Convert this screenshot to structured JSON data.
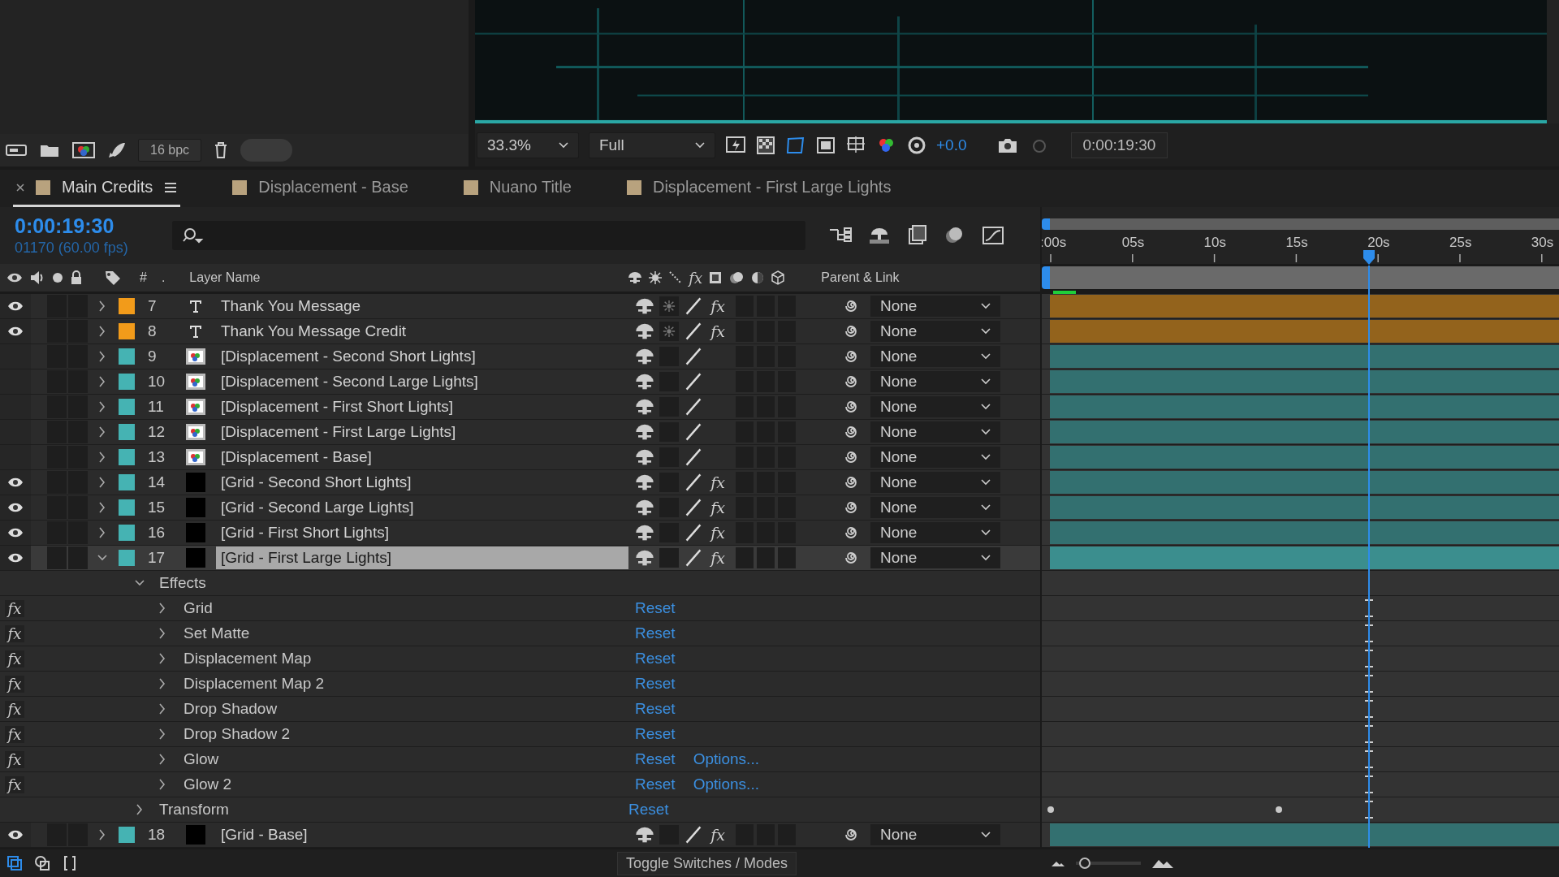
{
  "project_panel": {
    "bit_depth": "16 bpc"
  },
  "viewer": {
    "zoom": "33.3%",
    "resolution": "Full",
    "exposure": "+0.0",
    "timecode": "0:00:19:30"
  },
  "tabs": [
    {
      "label": "Main Credits",
      "selected": true
    },
    {
      "label": "Displacement - Base",
      "selected": false
    },
    {
      "label": "Nuano Title",
      "selected": false
    },
    {
      "label": "Displacement - First Large Lights",
      "selected": false
    }
  ],
  "timeline": {
    "current_time": "0:00:19:30",
    "frame_info": "01170 (60.00 fps)",
    "ruler": [
      ":00s",
      "05s",
      "10s",
      "15s",
      "20s",
      "25s",
      "30s"
    ]
  },
  "columns": {
    "number": "#",
    "marker": ".",
    "name": "Layer Name",
    "fx": "fx",
    "parent": "Parent & Link"
  },
  "layers": [
    {
      "number": "7",
      "name": "Thank You Message",
      "kind": "text",
      "color": "#f29b1a",
      "visible": true,
      "solo": false,
      "locked": false,
      "expanded": false,
      "selected": false,
      "collapse": true,
      "fx": "fx",
      "fx_on": true,
      "parent": "None"
    },
    {
      "number": "8",
      "name": "Thank You Message Credit",
      "kind": "text",
      "color": "#f29b1a",
      "visible": true,
      "solo": false,
      "locked": false,
      "expanded": false,
      "selected": false,
      "collapse": true,
      "fx": "fx",
      "fx_on": true,
      "parent": "None"
    },
    {
      "number": "9",
      "name": "[Displacement - Second Short Lights]",
      "kind": "precomp",
      "color": "#45b3b3",
      "visible": false,
      "solo": false,
      "locked": false,
      "expanded": false,
      "selected": false,
      "collapse": false,
      "parent": "None"
    },
    {
      "number": "10",
      "name": "[Displacement - Second Large Lights]",
      "kind": "precomp",
      "color": "#45b3b3",
      "visible": false,
      "solo": false,
      "locked": false,
      "expanded": false,
      "selected": false,
      "collapse": false,
      "parent": "None"
    },
    {
      "number": "11",
      "name": "[Displacement - First Short Lights]",
      "kind": "precomp",
      "color": "#45b3b3",
      "visible": false,
      "solo": false,
      "locked": false,
      "expanded": false,
      "selected": false,
      "collapse": false,
      "parent": "None"
    },
    {
      "number": "12",
      "name": "[Displacement - First Large Lights]",
      "kind": "precomp",
      "color": "#45b3b3",
      "visible": false,
      "solo": false,
      "locked": false,
      "expanded": false,
      "selected": false,
      "collapse": false,
      "parent": "None"
    },
    {
      "number": "13",
      "name": "[Displacement - Base]",
      "kind": "precomp",
      "color": "#45b3b3",
      "visible": false,
      "solo": false,
      "locked": false,
      "expanded": false,
      "selected": false,
      "collapse": false,
      "parent": "None"
    },
    {
      "number": "14",
      "name": "[Grid - Second Short Lights]",
      "kind": "solid",
      "color": "#45b3b3",
      "visible": true,
      "solo": false,
      "locked": false,
      "expanded": false,
      "selected": false,
      "collapse": false,
      "fx": "fx",
      "fx_on": true,
      "parent": "None"
    },
    {
      "number": "15",
      "name": "[Grid - Second Large Lights]",
      "kind": "solid",
      "color": "#45b3b3",
      "visible": true,
      "solo": false,
      "locked": false,
      "expanded": false,
      "selected": false,
      "collapse": false,
      "fx": "fx",
      "fx_on": true,
      "parent": "None"
    },
    {
      "number": "16",
      "name": "[Grid - First Short Lights]",
      "kind": "solid",
      "color": "#45b3b3",
      "visible": true,
      "solo": false,
      "locked": false,
      "expanded": false,
      "selected": false,
      "collapse": false,
      "fx": "fx",
      "fx_on": true,
      "parent": "None"
    },
    {
      "number": "17",
      "name": "[Grid - First Large Lights]",
      "kind": "solid",
      "color": "#45b3b3",
      "visible": true,
      "solo": false,
      "locked": false,
      "expanded": true,
      "selected": true,
      "collapse": false,
      "fx": "fx",
      "fx_on": true,
      "parent": "None",
      "effects": {
        "label": "Effects",
        "expanded": true,
        "items": [
          {
            "badge": "fx",
            "name": "Grid",
            "reset": "Reset"
          },
          {
            "badge": "fx",
            "name": "Set Matte",
            "reset": "Reset"
          },
          {
            "badge": "fx",
            "name": "Displacement Map",
            "reset": "Reset"
          },
          {
            "badge": "fx",
            "name": "Displacement Map 2",
            "reset": "Reset"
          },
          {
            "badge": "fx",
            "name": "Drop Shadow",
            "reset": "Reset"
          },
          {
            "badge": "fx",
            "name": "Drop Shadow 2",
            "reset": "Reset"
          },
          {
            "badge": "fx",
            "name": "Glow",
            "reset": "Reset",
            "options": "Options..."
          },
          {
            "badge": "fx",
            "name": "Glow 2",
            "reset": "Reset",
            "options": "Options..."
          }
        ]
      },
      "transform": {
        "label": "Transform",
        "reset": "Reset",
        "expanded": false
      }
    },
    {
      "number": "18",
      "name": "[Grid - Base]",
      "kind": "solid",
      "color": "#45b3b3",
      "visible": true,
      "solo": false,
      "locked": false,
      "expanded": false,
      "selected": false,
      "collapse": false,
      "fx": "fx",
      "fx_on": true,
      "parent": "None"
    }
  ],
  "bottom_bar": {
    "toggle": "Toggle Switches / Modes",
    "zoom": {
      "level": 0.05
    }
  }
}
